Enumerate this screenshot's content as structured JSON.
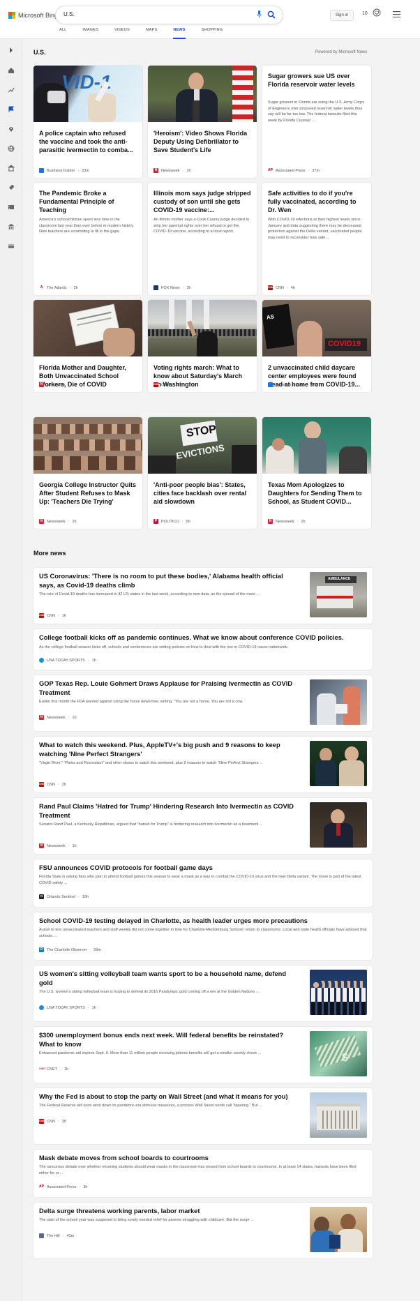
{
  "header": {
    "brand": "Microsoft Bing",
    "search_value": "U.S.",
    "sign_in": "Sign in",
    "points": "10"
  },
  "tabs": [
    "ALL",
    "IMAGES",
    "VIDEOS",
    "MAPS",
    "NEWS",
    "SHOPPING"
  ],
  "active_tab": "NEWS",
  "section": {
    "title": "U.S.",
    "powered": "Powered by Microsoft News"
  },
  "cards": [
    {
      "title": "A police captain who refused the vaccine and took the anti-parasitic ivermectin to comba...",
      "source": "Business Insider",
      "time": "23m",
      "icon": "bi"
    },
    {
      "title": "'Heroism': Video Shows Florida Deputy Using Defibrillator to Save Student's Life",
      "source": "Newsweek",
      "time": "1h",
      "icon": "nw"
    },
    {
      "title": "Sugar growers sue US over Florida reservoir water levels",
      "desc": "Sugar growers in Florida are suing the U.S. Army Corps of Engineers over proposed reservoir water levels they say will be far too low. The federal lawsuits filed this week by Florida Crystals' ...",
      "source": "Associated Press",
      "time": "37m",
      "icon": "ap"
    },
    {
      "title": "The Pandemic Broke a Fundamental Principle of Teaching",
      "desc": "America's schoolchildren spent less time in the classroom last year than ever before in modern history. Now teachers are scrambling to fill in the gaps.",
      "source": "The Atlantic",
      "time": "2h",
      "icon": "at"
    },
    {
      "title": "Illinois mom says judge stripped custody of son until she gets COVID-19 vaccine:...",
      "desc": "An Illinois mother says a Cook County judge decided to strip her parental rights over her refusal to get the COVID-19 vaccine, according to a local report.",
      "source": "FOX News",
      "time": "3h",
      "icon": "fox"
    },
    {
      "title": "Safe activities to do if you're fully vaccinated, according to Dr. Wen",
      "desc": "With COVID-19 infections at their highest levels since January and data suggesting there may be decreased protection against the Delta variant, vaccinated people may need to reconsider how safe ...",
      "source": "CNN",
      "time": "4h",
      "icon": "cnn"
    },
    {
      "title": "Florida Mother and Daughter, Both Unvaccinated School Workers, Die of COVID",
      "source": "Newsweek",
      "time": "1h",
      "icon": "nw"
    },
    {
      "title": "Voting rights march: What to know about Saturday's March on Washington",
      "source": "CNN",
      "time": "5h",
      "icon": "cnn"
    },
    {
      "title": "2 unvaccinated child daycare center employees were found dead at home from COVID-19...",
      "source": "Business Insider",
      "time": "22m",
      "icon": "bi"
    },
    {
      "title": "Georgia College Instructor Quits After Student Refuses to Mask Up: 'Teachers Die Trying'",
      "source": "Newsweek",
      "time": "2h",
      "icon": "nw"
    },
    {
      "title": "'Anti-poor people bias': States, cities face backlash over rental aid slowdown",
      "source": "POLITICO",
      "time": "5h",
      "icon": "pol"
    },
    {
      "title": "Texas Mom Apologizes to Daughters for Sending Them to School, as Student COVID...",
      "source": "Newsweek",
      "time": "2h",
      "icon": "nw"
    }
  ],
  "more_news_title": "More news",
  "more_news": [
    {
      "title": "US Coronavirus: 'There is no room to put these bodies,' Alabama health official says, as Covid-19 deaths climb",
      "desc": "The rate of Covid-19 deaths has increased in 42 US states in the last week, according to new data, as the spread of the more ...",
      "source": "CNN",
      "time": "1h",
      "icon": "cnn",
      "thumb": "ambulance"
    },
    {
      "title": "College football kicks off as pandemic continues. What we know about conference COVID policies.",
      "desc": "As the college football season kicks off, schools and conferences are setting policies on how to deal with the rise in COVID-19 cases nationwide.",
      "source": "USA TODAY SPORTS",
      "time": "1h",
      "icon": "usa",
      "thumb": ""
    },
    {
      "title": "GOP Texas Rep. Louie Gohmert Draws Applause for Praising Ivermectin as COVID Treatment",
      "desc": "Earlier this month the FDA warned against using the horse dewormer, writing, \"You are not a horse. You are not a cow.",
      "source": "Newsweek",
      "time": "1h",
      "icon": "nw",
      "thumb": "hospital"
    },
    {
      "title": "What to watch this weekend. Plus, AppleTV+'s big push and 9 reasons to keep watching 'Nine Perfect Strangers'",
      "desc": "\"Virgin River,\" \"Parks and Recreation\" and other shows to watch this weekend, plus 9 reasons to watch \"Nine Perfect Strangers ...",
      "source": "CNN",
      "time": "2h",
      "icon": "cnn",
      "thumb": "show"
    },
    {
      "title": "Rand Paul Claims 'Hatred for Trump' Hindering Research Into Ivermectin as COVID Treatment",
      "desc": "Senator Rand Paul, a Kentucky Republican, argued that \"hatred for Trump\" is hindering research into ivermectin as a treatment ...",
      "source": "Newsweek",
      "time": "1h",
      "icon": "nw",
      "thumb": "senator"
    },
    {
      "title": "FSU announces COVID protocols for football game days",
      "desc": "Florida State is asking fans who plan to attend football games this season to wear a mask as a way to combat the COVID-19 virus and the new Delta variant. The move is part of the latest COVID safety ...",
      "source": "Orlando Sentinel",
      "time": "19h",
      "icon": "os",
      "thumb": ""
    },
    {
      "title": "School COVID-19 testing delayed in Charlotte, as health leader urges more precautions",
      "desc": "A plan to test unvaccinated teachers and staff weekly did not come together in time for Charlotte-Mecklenburg Schools' return to classrooms. Local and state health officials have advised that schools ...",
      "source": "The Charlotte Observer",
      "time": "59m",
      "icon": "co",
      "thumb": ""
    },
    {
      "title": "US women's sitting volleyball team wants sport to be a household name, defend gold",
      "desc": "The U.S. women's sitting volleyball team is hoping to defend its 2016 Paralympic gold coming off a win at the Golden Nations ...",
      "source": "USA TODAY SPORTS",
      "time": "1h",
      "icon": "usa",
      "thumb": "team"
    },
    {
      "title": "$300 unemployment bonus ends next week. Will federal benefits be reinstated? What to know",
      "desc": "Enhanced pandemic aid expires Sept. 6. More than 11 million people receiving jobless benefits will get a smaller weekly check ...",
      "source": "CNET",
      "time": "1h",
      "icon": "cnet",
      "thumb": "money"
    },
    {
      "title": "Why the Fed is about to stop the party on Wall Street (and what it means for you)",
      "desc": "The Federal Reserve will soon wind down its pandemic-era stimulus measures, a process Wall Street nerds call \"tapering.\" But ...",
      "source": "CNN",
      "time": "3h",
      "icon": "cnn",
      "thumb": "fed"
    },
    {
      "title": "Mask debate moves from school boards to courtrooms",
      "desc": "The rancorous debate over whether returning students should wear masks in the classroom has moved from school boards to courtrooms. In at least 14 states, lawsuits have been filed either for or ...",
      "source": "Associated Press",
      "time": "3h",
      "icon": "ap",
      "thumb": ""
    },
    {
      "title": "Delta surge threatens working parents, labor market",
      "desc": "The start of the school year was supposed to bring sorely needed relief for parents struggling with childcare. But the surge ...",
      "source": "The Hill",
      "time": "43m",
      "icon": "hill",
      "thumb": "kids"
    }
  ],
  "source_colors": {
    "bi": "#1a73e8",
    "nw": "#e0202e",
    "ap": "#b00",
    "at": "#c00",
    "fox": "#1b3a6b",
    "cnn": "#cc0000",
    "pol": "#d0112b",
    "usa": "#1d8ce0",
    "os": "#222",
    "co": "#1f7ab8",
    "cnet": "#e23",
    "hill": "#5b6b8a"
  },
  "accent": "#174ae4"
}
